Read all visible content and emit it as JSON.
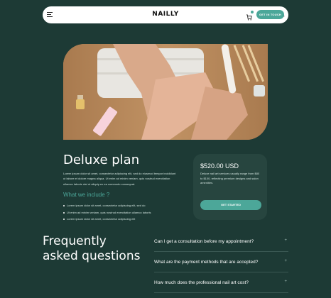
{
  "header": {
    "logo": "NAILLY",
    "cta_label": "GET IN TOUCH",
    "icons": [
      "menu-icon",
      "search-icon",
      "cart-icon"
    ]
  },
  "hero": {
    "image": "manicure photo"
  },
  "plan": {
    "title": "Deluxe plan",
    "description": "Lorem ipsum dolor sit amet, consectetur adipiscing elit, sed do eiusmod tempor incididunt ut labore et dolore magna aliqua. Ut enim ad minim veniam, quis nostrud exercitation ullamco laboris nisi ut aliquip ex ea commodo consequat.",
    "include_title": "What we include ?",
    "include_items": [
      "Lorem ipsum dolor sit amet, consectetur adipiscing elit, sed do",
      "Ut enim ad minim veniam, quis nostrud exercitation ullamco laboris",
      "Lorem ipsum dolor sit amet, consectetur adipiscing elit"
    ]
  },
  "price_card": {
    "price": "$520.00 USD",
    "description": "Deluxe nail art services usually range from $80 to $100, reflecting premium designs and salon amenities.",
    "button_label": "GET STARTED"
  },
  "faq": {
    "title_line1": "Frequently",
    "title_line2": "asked questions",
    "items": [
      "Can I get a consultation before my appointment?",
      "What are the payment methods that are accepted?",
      "How much does the professional nail art cost?"
    ]
  },
  "colors": {
    "background": "#1d3a35",
    "accent": "#4ca799",
    "card": "#27453f"
  }
}
